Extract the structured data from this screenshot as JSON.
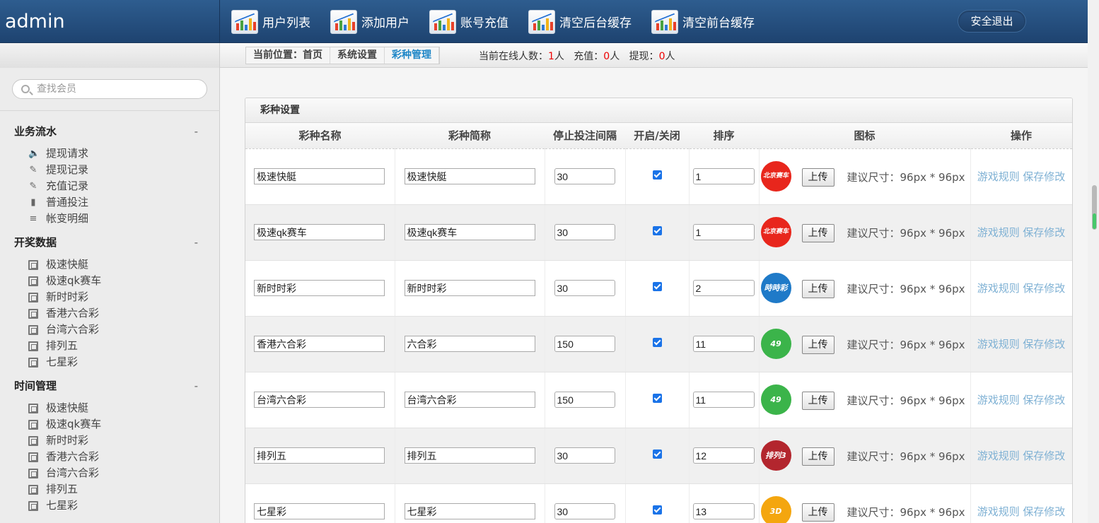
{
  "brand": "admin",
  "nav": [
    {
      "label": "用户列表",
      "icon": "chart-icon"
    },
    {
      "label": "添加用户",
      "icon": "chart-icon"
    },
    {
      "label": "账号充值",
      "icon": "chart-icon"
    },
    {
      "label": "清空后台缓存",
      "icon": "chart-icon"
    },
    {
      "label": "清空前台缓存",
      "icon": "chart-icon"
    }
  ],
  "logout_label": "安全退出",
  "breadcrumb": [
    "当前位置：首页",
    "系统设置",
    "彩种管理"
  ],
  "online": {
    "online_label": "当前在线人数：",
    "online_value": "1",
    "online_unit": "人",
    "recharge_label": "充值：",
    "recharge_value": "0",
    "recharge_unit": "人",
    "withdraw_label": "提现：",
    "withdraw_value": "0",
    "withdraw_unit": "人"
  },
  "search": {
    "placeholder": "查找会员"
  },
  "sidebar": {
    "groups": [
      {
        "title": "业务流水",
        "toggle": "-",
        "items": [
          "提现请求",
          "提现记录",
          "充值记录",
          "普通投注",
          "帐变明细"
        ]
      },
      {
        "title": "开奖数据",
        "toggle": "-",
        "items": [
          "极速快艇",
          "极速qk赛车",
          "新时时彩",
          "香港六合彩",
          "台湾六合彩",
          "排列五",
          "七星彩"
        ]
      },
      {
        "title": "时间管理",
        "toggle": "-",
        "items": [
          "极速快艇",
          "极速qk赛车",
          "新时时彩",
          "香港六合彩",
          "台湾六合彩",
          "排列五",
          "七星彩"
        ]
      }
    ]
  },
  "panel": {
    "title": "彩种设置",
    "columns": [
      "彩种名称",
      "彩种简称",
      "停止投注间隔",
      "开启/关闭",
      "排序",
      "图标",
      "操作"
    ],
    "upload_label": "上传",
    "size_hint": "建议尺寸：96px * 96px",
    "op_rules": "游戏规则",
    "op_save": "保存修改",
    "rows": [
      {
        "name": "极速快艇",
        "short": "极速快艇",
        "interval": "30",
        "enabled": true,
        "sort": "1",
        "logo": "北京赛车",
        "logo_color": "#e8261c"
      },
      {
        "name": "极速qk赛车",
        "short": "极速qk赛车",
        "interval": "30",
        "enabled": true,
        "sort": "1",
        "logo": "北京赛车",
        "logo_color": "#e8261c"
      },
      {
        "name": "新时时彩",
        "short": "新时时彩",
        "interval": "30",
        "enabled": true,
        "sort": "2",
        "logo": "時時彩",
        "logo_color": "#1f7ac8"
      },
      {
        "name": "香港六合彩",
        "short": "六合彩",
        "interval": "150",
        "enabled": true,
        "sort": "11",
        "logo": "49",
        "logo_color": "#3bb44a"
      },
      {
        "name": "台湾六合彩",
        "short": "台湾六合彩",
        "interval": "150",
        "enabled": true,
        "sort": "11",
        "logo": "49",
        "logo_color": "#3bb44a"
      },
      {
        "name": "排列五",
        "short": "排列五",
        "interval": "30",
        "enabled": true,
        "sort": "12",
        "logo": "排列3",
        "logo_color": "#b3262e"
      },
      {
        "name": "七星彩",
        "short": "七星彩",
        "interval": "30",
        "enabled": true,
        "sort": "13",
        "logo": "3D",
        "logo_color": "#f4a60f"
      }
    ]
  }
}
